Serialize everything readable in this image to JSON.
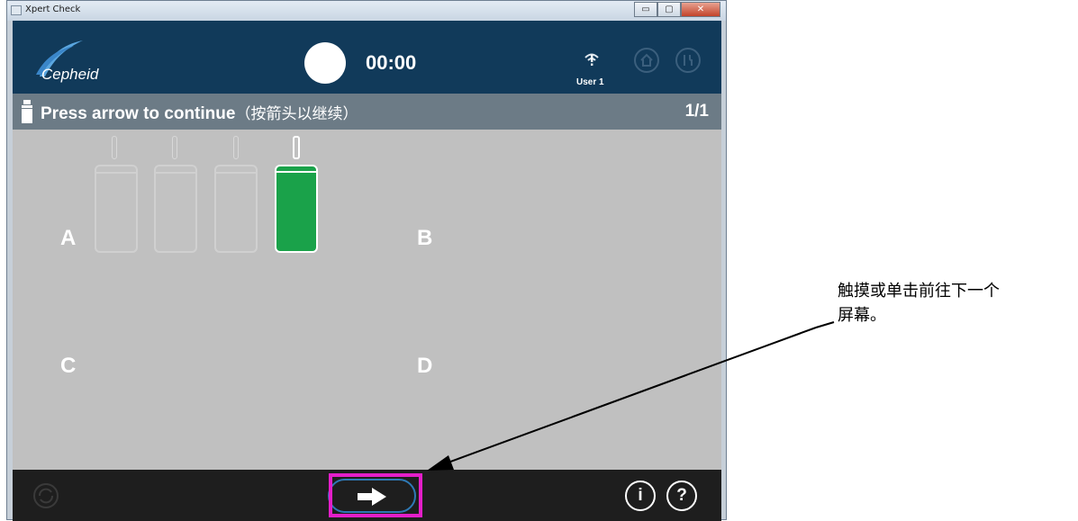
{
  "window": {
    "title": "Xpert Check",
    "controls": {
      "minimize": "▭",
      "maximize": "▢",
      "close": "✕"
    }
  },
  "header": {
    "logo_text": "Cepheid",
    "timer": "00:00",
    "user": "User 1",
    "icons": [
      "wifi-icon",
      "home-icon",
      "tools-icon"
    ]
  },
  "instruction": {
    "text": "Press arrow to continue",
    "text_cn": "（按箭头以继续）",
    "page": "1/1"
  },
  "modules": {
    "letters": [
      "A",
      "B",
      "C",
      "D"
    ],
    "active_index": 3
  },
  "footer": {
    "info_label": "i",
    "help_label": "?"
  },
  "callout": {
    "line1": "触摸或单击前往下一个",
    "line2": "屏幕。"
  },
  "colors": {
    "header": "#113a5a",
    "instruction_bar": "#6c7b86",
    "body": "#c0c0c0",
    "footer": "#1e1e1e",
    "active_cartridge": "#1aa24a",
    "highlight": "#e41ec9",
    "arrow_button_border": "#2e79b5"
  }
}
